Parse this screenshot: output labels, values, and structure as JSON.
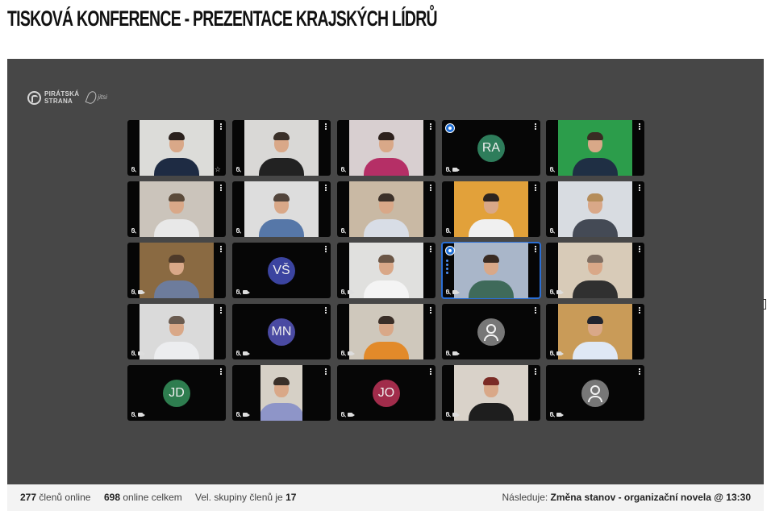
{
  "page_title": "TISKOVÁ KONFERENCE - PREZENTACE KRAJSKÝCH LÍDRŮ",
  "brand": {
    "line1": "PIRÁTSKÁ",
    "line2": "STRANA",
    "secondary": "jitsi"
  },
  "footer": {
    "online_members_count": "277",
    "online_members_label": "členů online",
    "online_total_count": "698",
    "online_total_label": "online celkem",
    "group_size_label": "Vel. skupiny členů je",
    "group_size_value": "17",
    "next_label": "Následuje:",
    "next_item": "Změna stanov - organizační novela @ 13:30"
  },
  "participants": [
    {
      "type": "video",
      "bg": "#dcdcd9",
      "shirt": "#1e2b43",
      "hair": "#2a211d"
    },
    {
      "type": "video",
      "bg": "#d9d8d6",
      "shirt": "#222222",
      "hair": "#3a3029"
    },
    {
      "type": "video",
      "bg": "#d8cfd0",
      "shirt": "#b52f66",
      "hair": "#2d211c"
    },
    {
      "type": "initials",
      "initials": "RA",
      "color": "#2e7d5b",
      "moderator": true
    },
    {
      "type": "video",
      "bg": "#2c9d4b",
      "shirt": "#1f2f44",
      "hair": "#392b23"
    },
    {
      "type": "video",
      "bg": "#cbc4bb",
      "shirt": "#e8e8e8",
      "hair": "#5b4a3a"
    },
    {
      "type": "video",
      "bg": "#dddddd",
      "shirt": "#5677a8",
      "hair": "#52453c"
    },
    {
      "type": "video",
      "bg": "#c9b9a4",
      "shirt": "#d8dde6",
      "hair": "#3b3029"
    },
    {
      "type": "video",
      "bg": "#e2a13a",
      "shirt": "#f0f0f0",
      "hair": "#2d241f"
    },
    {
      "type": "video",
      "bg": "#d8dce1",
      "shirt": "#444a55",
      "hair": "#b58d5a"
    },
    {
      "type": "video",
      "bg": "#8a6a42",
      "shirt": "#6d7c9c",
      "hair": "#4e3a2a"
    },
    {
      "type": "initials",
      "initials": "VŠ",
      "color": "#3b44a0"
    },
    {
      "type": "video",
      "bg": "#e0e0de",
      "shirt": "#f4f4f4",
      "hair": "#6b5646"
    },
    {
      "type": "video",
      "bg": "#a9b6c9",
      "shirt": "#3f6a5a",
      "hair": "#3a2b22",
      "moderator": true,
      "active": true
    },
    {
      "type": "video",
      "bg": "#d8cbb8",
      "shirt": "#303030",
      "hair": "#7e6e62"
    },
    {
      "type": "video",
      "bg": "#dadada",
      "shirt": "#ecedef",
      "hair": "#6a5b50"
    },
    {
      "type": "initials",
      "initials": "MN",
      "color": "#4a4aa2"
    },
    {
      "type": "video",
      "bg": "#cfc8bc",
      "shirt": "#e28a2a",
      "hair": "#3a2e27"
    },
    {
      "type": "generic"
    },
    {
      "type": "video",
      "bg": "#c99b58",
      "shirt": "#dfe8f5",
      "hair": "#20242e"
    },
    {
      "type": "initials",
      "initials": "JD",
      "color": "#2e7d4f"
    },
    {
      "type": "video",
      "bg": "#d6d0c6",
      "shirt": "#8e95c8",
      "hair": "#3a3029",
      "pillar": true
    },
    {
      "type": "initials",
      "initials": "JO",
      "color": "#a12c4b"
    },
    {
      "type": "video",
      "bg": "#d9d2c9",
      "shirt": "#1e1e1e",
      "hair": "#7b2b25"
    },
    {
      "type": "generic"
    }
  ]
}
